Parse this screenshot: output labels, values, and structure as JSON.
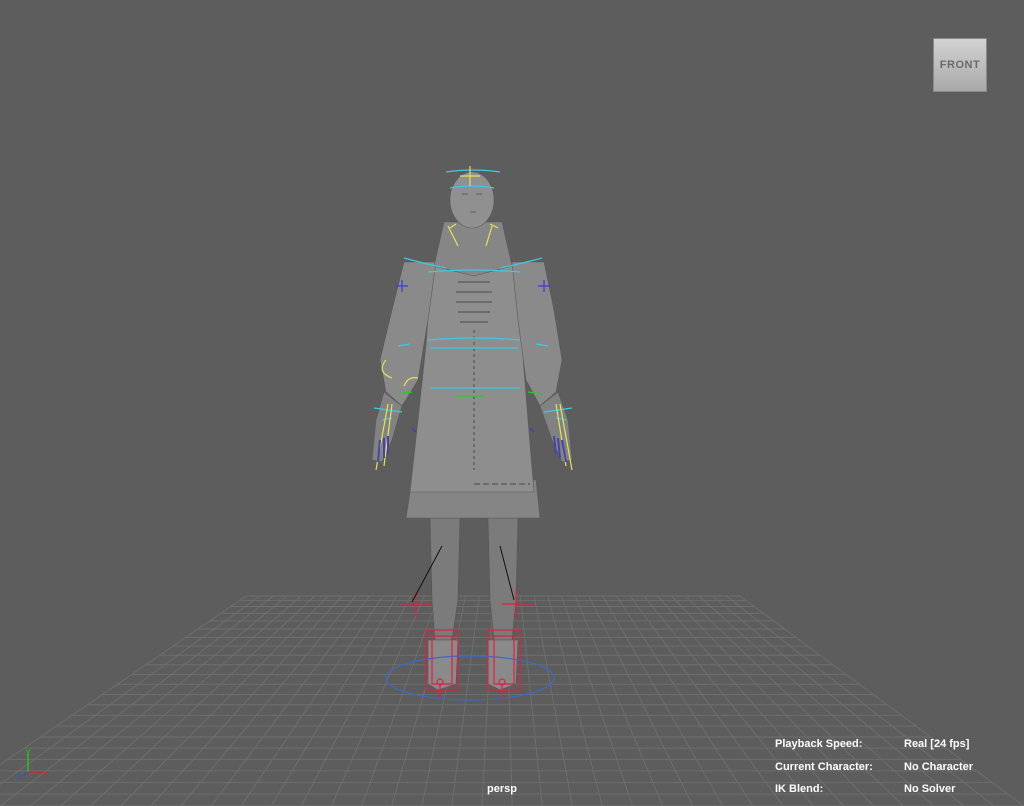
{
  "viewport": {
    "camera": "persp",
    "viewcube_label": "FRONT"
  },
  "hud": [
    {
      "label": "Playback Speed:",
      "value": "Real [24 fps]"
    },
    {
      "label": "Current Character:",
      "value": "No Character"
    },
    {
      "label": "IK Blend:",
      "value": "No Solver"
    }
  ],
  "axis": {
    "y": "y",
    "x": "x",
    "z": "z"
  },
  "colors": {
    "background": "#5d5d5d",
    "grid": "#6f6f6f",
    "mesh": "#8c8c8c",
    "control_cyan": "#3fc8e6",
    "control_yellow": "#e8e05a",
    "control_blue": "#3a3ad0",
    "control_red": "#e02040",
    "control_green": "#20d020"
  }
}
